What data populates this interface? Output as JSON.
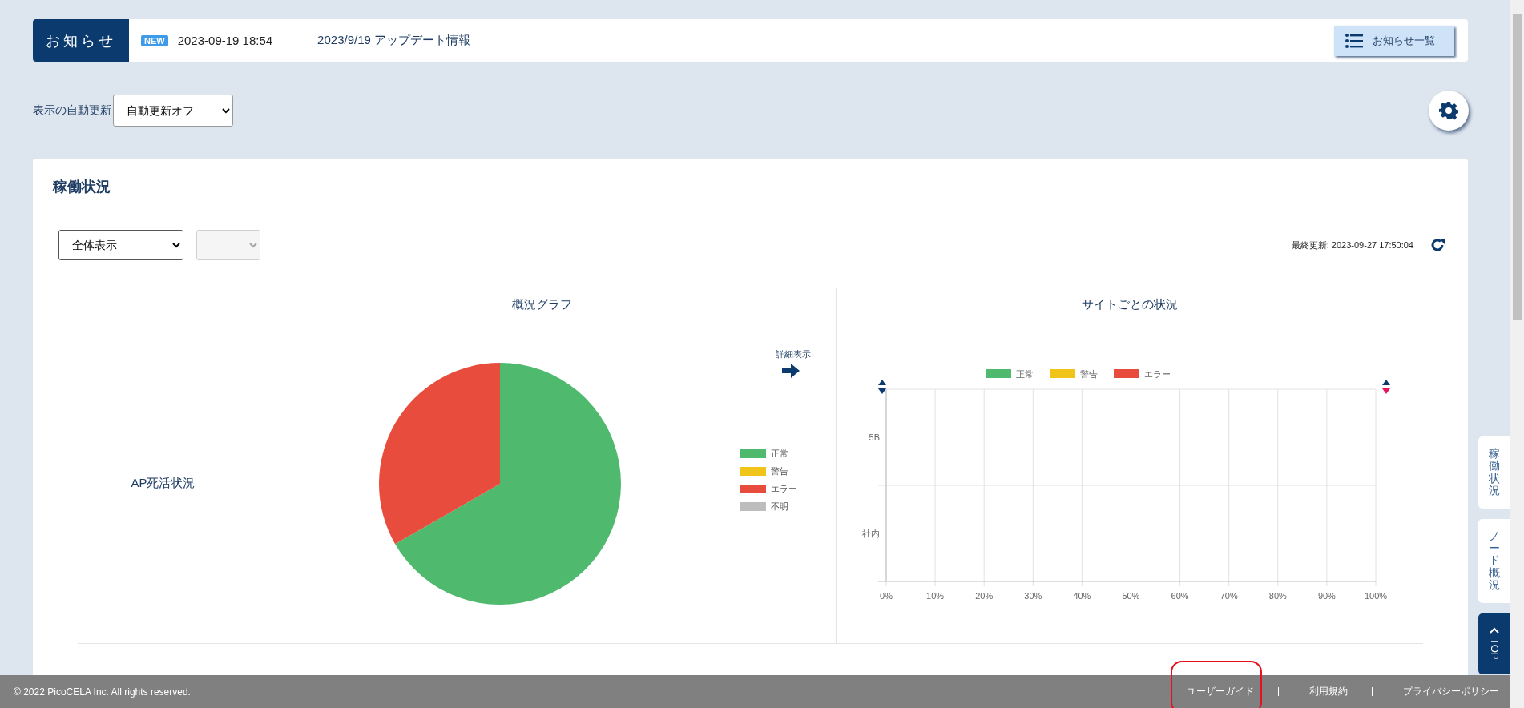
{
  "notice": {
    "label": "お知らせ",
    "badge": "NEW",
    "datetime": "2023-09-19 18:54",
    "message": "2023/9/19 アップデート情報",
    "list_button": "お知らせ一覧"
  },
  "auto_refresh": {
    "label": "表示の自動更新",
    "value": "自動更新オフ"
  },
  "panel": {
    "title": "稼働状況",
    "filter": {
      "value": "全体表示"
    },
    "sub_filter": {
      "disabled": true
    },
    "last_updated": "最終更新: 2023-09-27 17:50:04",
    "overview": {
      "title": "概況グラフ",
      "row_label": "AP死活状況",
      "detail_link": "詳細表示",
      "legend": [
        {
          "label": "正常",
          "color": "#4fb96e"
        },
        {
          "label": "警告",
          "color": "#f0c419"
        },
        {
          "label": "エラー",
          "color": "#e74c3c"
        },
        {
          "label": "不明",
          "color": "#bdbdbd"
        }
      ],
      "chart_data": {
        "type": "pie",
        "values": [
          66.7,
          0,
          33.3,
          0
        ]
      }
    },
    "sites": {
      "title": "サイトごとの状況",
      "chart_data": {
        "type": "bar",
        "orientation": "horizontal",
        "categories": [
          "5B",
          "社内"
        ],
        "series": [
          {
            "name": "正常",
            "color": "#4fb96e",
            "values": [
              0,
              0
            ]
          },
          {
            "name": "警告",
            "color": "#f0c419",
            "values": [
              0,
              0
            ]
          },
          {
            "name": "エラー",
            "color": "#e74c3c",
            "values": [
              0,
              0
            ]
          }
        ],
        "xlim": [
          0,
          100
        ],
        "grid": true,
        "xticks": [
          {
            "value": 0,
            "label": "0%"
          },
          {
            "value": 10,
            "label": "10%"
          },
          {
            "value": 20,
            "label": "20%"
          },
          {
            "value": 30,
            "label": "30%"
          },
          {
            "value": 40,
            "label": "40%"
          },
          {
            "value": 50,
            "label": "50%"
          },
          {
            "value": 60,
            "label": "60%"
          },
          {
            "value": 70,
            "label": "70%"
          },
          {
            "value": 80,
            "label": "80%"
          },
          {
            "value": 90,
            "label": "90%"
          },
          {
            "value": 100,
            "label": "100%"
          }
        ]
      }
    }
  },
  "side_tabs": [
    {
      "label": "稼働状況"
    },
    {
      "label": "ノード概況"
    }
  ],
  "top_button": "TOP",
  "footer": {
    "copyright": "© 2022 PicoCELA Inc. All rights reserved.",
    "links": [
      {
        "label": "ユーザーガイド",
        "highlighted": true
      },
      {
        "label": "利用規約",
        "highlighted": false
      },
      {
        "label": "プライバシーポリシー",
        "highlighted": false
      }
    ]
  }
}
